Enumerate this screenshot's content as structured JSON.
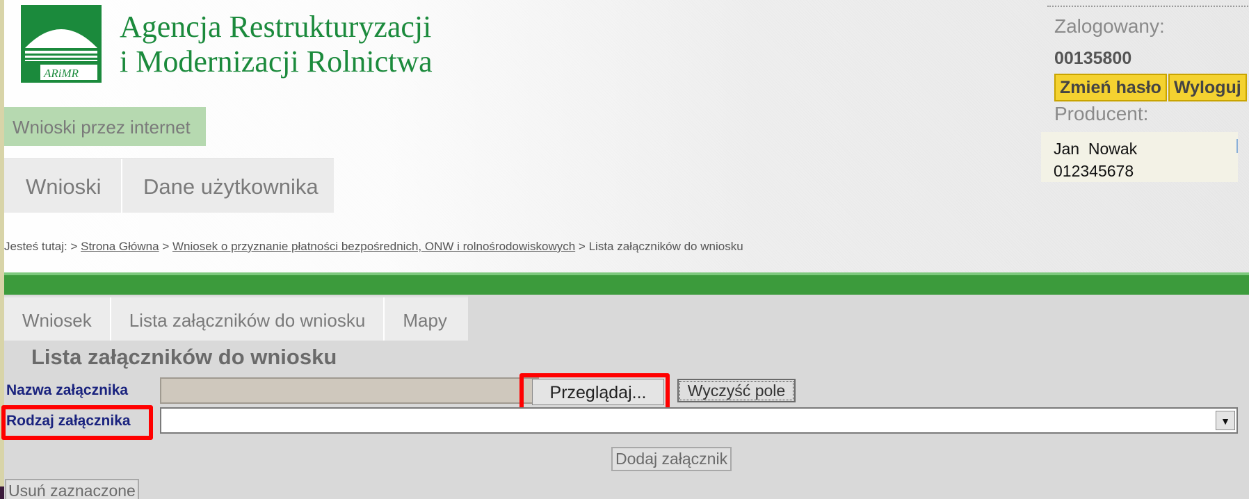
{
  "brand": {
    "logo_text": "ARiMR",
    "title_line1": "Agencja Restrukturyzacji",
    "title_line2": "i Modernizacji Rolnictwa",
    "color": "#1b8a3c"
  },
  "app_name": "Wnioski przez internet",
  "main_nav": [
    "Wnioski",
    "Dane użytkownika"
  ],
  "user": {
    "logged_label": "Zalogowany:",
    "login": "00135800",
    "change_password": "Zmień hasło",
    "logout": "Wyloguj",
    "producer_label": "Producent:",
    "producer_name": "Jan  Nowak",
    "producer_id": "012345678"
  },
  "breadcrumb": {
    "prefix": "Jesteś tutaj:",
    "sep": ">",
    "links": [
      "Strona Główna",
      "Wniosek o przyznanie płatności bezpośrednich, ONW i rolnośrodowiskowych"
    ],
    "current": "Lista załączników do wniosku"
  },
  "sub_tabs": [
    "Wniosek",
    "Lista załączników do wniosku",
    "Mapy"
  ],
  "page_title": "Lista załączników do wniosku",
  "form": {
    "name_label": "Nazwa załącznika",
    "file_value": "",
    "browse_label": "Przeglądaj...",
    "clear_label": "Wyczyść pole",
    "type_label": "Rodzaj załącznika",
    "type_value": "",
    "add_label": "Dodaj załącznik",
    "delete_label": "Usuń zaznaczone"
  },
  "colors": {
    "accent_green": "#3c9b3c",
    "button_yellow": "#f4d230",
    "highlight_red": "#ff0000",
    "label_navy": "#1a237e"
  },
  "icons": {
    "logo": "arimr-sun-field-logo",
    "dropdown": "dropdown-arrow-icon"
  }
}
